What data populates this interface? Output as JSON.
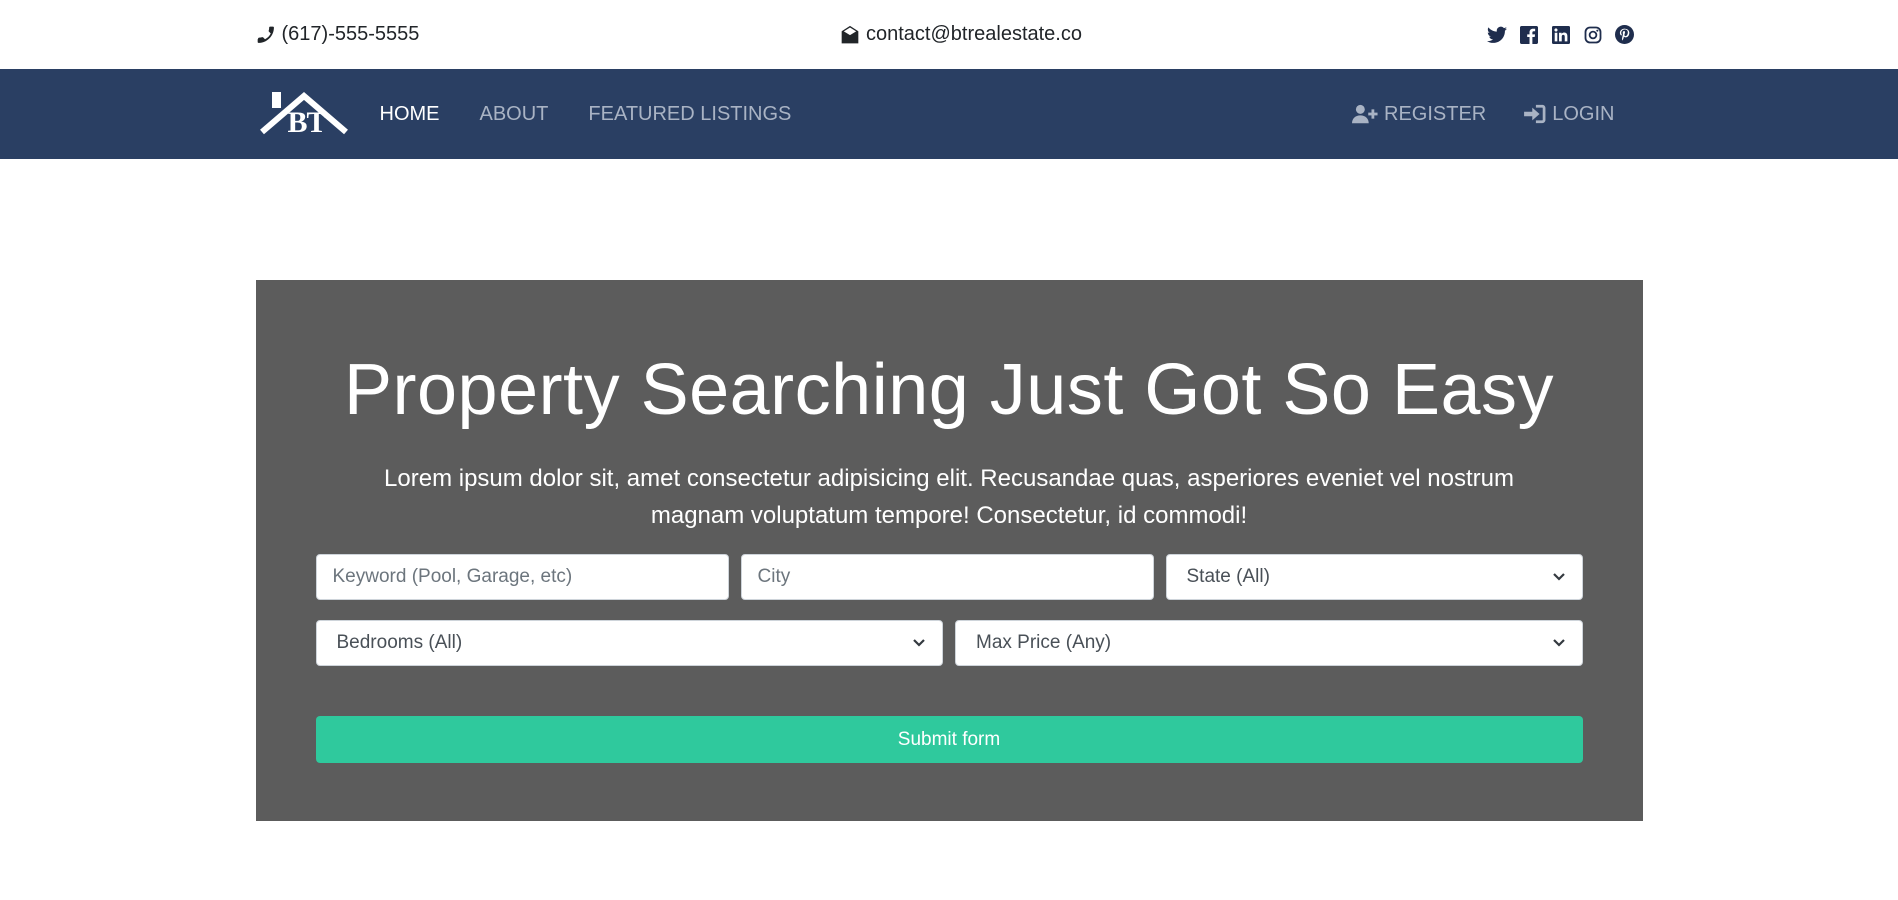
{
  "topbar": {
    "phone": "(617)-555-5555",
    "email": "contact@btrealestate.co",
    "socials": [
      "twitter-icon",
      "facebook-icon",
      "linkedin-icon",
      "instagram-icon",
      "pinterest-icon"
    ]
  },
  "navbar": {
    "logo_text": "BT",
    "links": [
      "HOME",
      "ABOUT",
      "FEATURED LISTINGS"
    ],
    "register": "REGISTER",
    "login": "LOGIN",
    "bg_color": "#2a3f63"
  },
  "hero": {
    "title": "Property Searching Just Got So Easy",
    "lead": "Lorem ipsum dolor sit, amet consectetur adipisicing elit. Recusandae quas, asperiores eveniet vel nostrum magnam voluptatum tempore! Consectetur, id commodi!",
    "keyword_placeholder": "Keyword (Pool, Garage, etc)",
    "city_placeholder": "City",
    "state_select": "State (All)",
    "bedrooms_select": "Bedrooms (All)",
    "price_select": "Max Price (Any)",
    "submit_label": "Submit form",
    "bg_color": "#5c5c5c",
    "button_color": "#2fc99d"
  }
}
